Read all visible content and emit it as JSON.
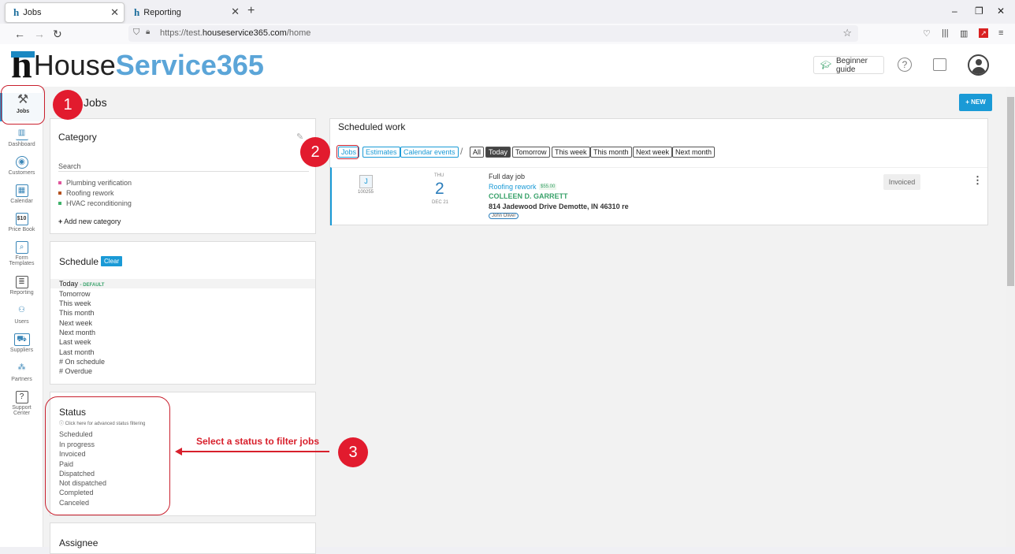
{
  "browser": {
    "tabs": [
      {
        "label": "Jobs"
      },
      {
        "label": "Reporting"
      }
    ],
    "new_tab_glyph": "+",
    "url_prefix": "https://test.",
    "url_domain": "houseservice365.com",
    "url_path": "/home",
    "window_controls": [
      "–",
      "❐",
      "✕"
    ]
  },
  "app": {
    "logo_house": "House",
    "logo_service": "Service365",
    "beginner_guide": "Beginner guide",
    "help_glyph": "?",
    "page_title": "Jobs",
    "new_button": "+ NEW"
  },
  "sidebar": {
    "items": [
      {
        "label": "Jobs",
        "icon": "tools-icon"
      },
      {
        "label": "Dashboard",
        "icon": "chart-icon"
      },
      {
        "label": "Customers",
        "icon": "customers-icon"
      },
      {
        "label": "Calendar",
        "icon": "calendar-icon"
      },
      {
        "label": "Price Book",
        "icon": "price-book-icon"
      },
      {
        "label": "Form Templates",
        "icon": "form-icon"
      },
      {
        "label": "Reporting",
        "icon": "report-icon"
      },
      {
        "label": "Users",
        "icon": "users-icon"
      },
      {
        "label": "Suppliers",
        "icon": "truck-icon"
      },
      {
        "label": "Partners",
        "icon": "partners-icon"
      },
      {
        "label": "Support Center",
        "icon": "support-icon"
      }
    ],
    "price_book_glyph": "$10",
    "support_glyph": "?"
  },
  "category": {
    "title": "Category",
    "search_placeholder": "Search",
    "items": [
      {
        "label": "Plumbing verification",
        "color": "#e0569c"
      },
      {
        "label": "Roofing rework",
        "color": "#b5521f"
      },
      {
        "label": "HVAC reconditioning",
        "color": "#3fb26b"
      }
    ],
    "add_label": "Add new category"
  },
  "schedule": {
    "title": "Schedule",
    "clear_label": "Clear",
    "options": [
      "Today",
      "Tomorrow",
      "This week",
      "This month",
      "Next week",
      "Next month",
      "Last week",
      "Last month",
      "# On schedule",
      "# Overdue"
    ],
    "default_tag": "- DEFAULT"
  },
  "status": {
    "title": "Status",
    "hint": "ⓘ Click here for advanced status filtering",
    "options": [
      "Scheduled",
      "In progress",
      "Invoiced",
      "Paid",
      "Dispatched",
      "Not dispatched",
      "Completed",
      "Canceled"
    ]
  },
  "assignee": {
    "title": "Assignee"
  },
  "scheduled_work": {
    "title": "Scheduled work",
    "type_filters": [
      "Jobs",
      "Estimates",
      "Calendar events"
    ],
    "date_filters": [
      "All",
      "Today",
      "Tomorrow",
      "This week",
      "This month",
      "Next week",
      "Next month"
    ],
    "active_date_filter": "Today",
    "job": {
      "badge": "J",
      "number": "100255",
      "day_of_week": "THU",
      "day": "2",
      "month_year": "DEC 21",
      "title": "Full day job",
      "category": "Roofing rework",
      "price": "$55.00",
      "customer": "COLLEEN D. GARRETT",
      "address": "814 Jadewood Drive Demotte, IN 46310 re",
      "technician": "John Oliver",
      "status": "Invoiced"
    }
  },
  "annotations": {
    "step1": "1",
    "step2": "2",
    "step3": "3",
    "step3_text": "Select a status to filter jobs",
    "color": "#e21b2e"
  }
}
